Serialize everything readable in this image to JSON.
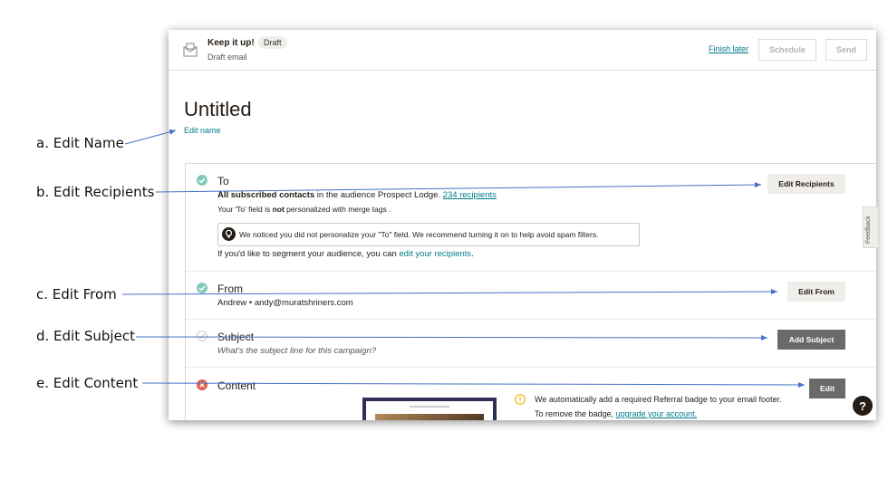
{
  "annotations": [
    {
      "id": "a",
      "label": "a. Edit Name"
    },
    {
      "id": "b",
      "label": "b. Edit Recipients"
    },
    {
      "id": "c",
      "label": "c. Edit From"
    },
    {
      "id": "d",
      "label": "d. Edit Subject"
    },
    {
      "id": "e",
      "label": "e. Edit Content"
    }
  ],
  "header": {
    "title": "Keep it up!",
    "badge": "Draft",
    "subtitle": "Draft email",
    "finish_later": "Finish later",
    "schedule": "Schedule",
    "send": "Send"
  },
  "campaign": {
    "name": "Untitled",
    "edit_name": "Edit name"
  },
  "to": {
    "label": "To",
    "line1_bold": "All subscribed contacts",
    "line1_mid": " in the audience ",
    "audience": "Prospect Lodge",
    "line1_end": ". ",
    "recipients_link": "234 recipients",
    "line2_a": "Your 'To' field is ",
    "line2_bold": "not",
    "line2_b": " personalized with merge tags .",
    "warning": "We noticed you did not personalize your \"To\" field. We recommend turning it on to help avoid spam filters.",
    "line3_a": "If you'd like to segment your audience, you can ",
    "line3_link": "edit your recipients",
    "line3_b": ".",
    "button": "Edit Recipients"
  },
  "from": {
    "label": "From",
    "value": "Andrew • andy@muratshriners.com",
    "button": "Edit From"
  },
  "subject": {
    "label": "Subject",
    "placeholder": "What's the subject line for this campaign?",
    "button": "Add Subject"
  },
  "content": {
    "label": "Content",
    "notice_line1": "We automatically add a required Referral badge to your email footer.",
    "notice_line2_a": "To remove the badge, ",
    "notice_link": "upgrade your account.",
    "button": "Edit"
  },
  "side": {
    "feedback": "Feedback",
    "help": "?"
  },
  "colors": {
    "accent": "#007c89",
    "success": "#82c8b9",
    "error": "#e0614c",
    "warning": "#e8b800",
    "dark_button": "#6b6a68"
  }
}
